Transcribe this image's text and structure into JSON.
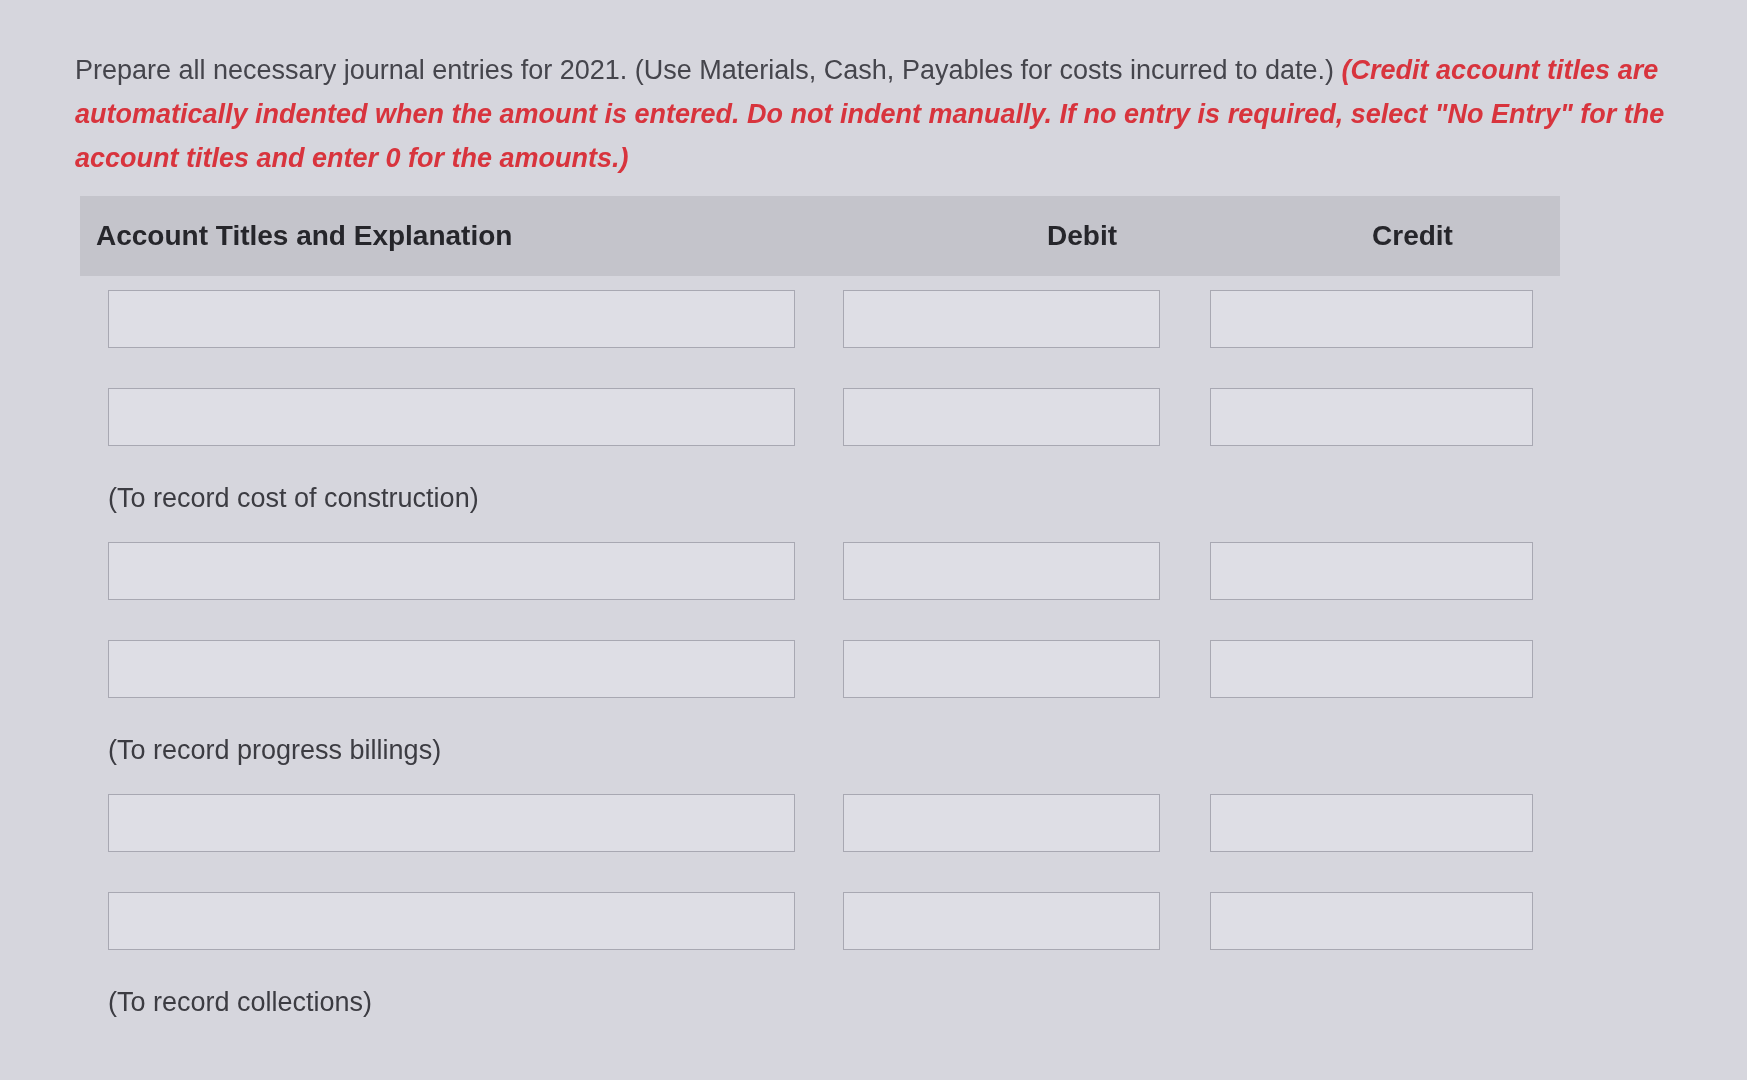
{
  "instructions": "Prepare all necessary journal entries for 2021. (Use Materials, Cash, Payables for costs incurred to date.) *(Credit account titles are automatically indented when the amount is entered. Do not indent manually. If no entry is required, select \"No Entry\" for the account titles and enter 0 for the amounts.)*",
  "table": {
    "columns": [
      "Account Titles and Explanation",
      "Debit",
      "Credit"
    ],
    "entries": [
      {
        "lines": [
          {
            "kind": "input_row"
          },
          {
            "kind": "input_row"
          }
        ],
        "explanation": "(To record cost of construction)"
      },
      {
        "lines": [
          {
            "kind": "input_row"
          },
          {
            "kind": "input_row"
          }
        ],
        "explanation": "(To record progress billings)"
      },
      {
        "lines": [
          {
            "kind": "input_row"
          },
          {
            "kind": "input_row"
          }
        ],
        "explanation": "(To record collections)"
      }
    ]
  }
}
